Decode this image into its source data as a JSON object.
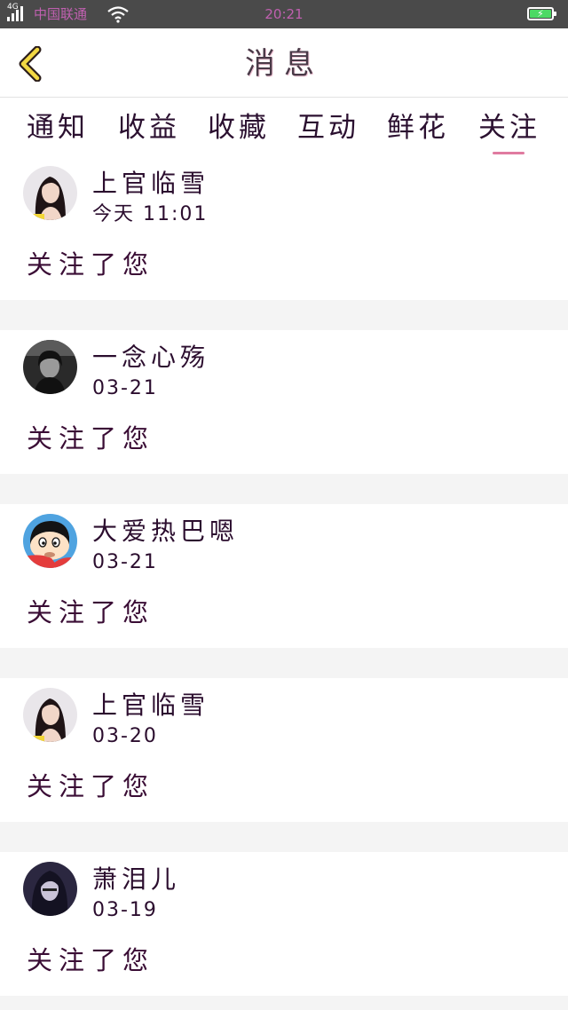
{
  "status_bar": {
    "network": "4G",
    "carrier": "中国联通",
    "time": "20:21"
  },
  "header": {
    "title": "消息"
  },
  "tabs": [
    {
      "label": "通知",
      "active": false
    },
    {
      "label": "收益",
      "active": false
    },
    {
      "label": "收藏",
      "active": false
    },
    {
      "label": "互动",
      "active": false
    },
    {
      "label": "鲜花",
      "active": false
    },
    {
      "label": "关注",
      "active": true
    }
  ],
  "colors": {
    "tab_underline": "#e07ba0",
    "text": "#2b0d2e"
  },
  "notifications": [
    {
      "name": "上官临雪",
      "time": "今天 11:01",
      "action": "关注了您",
      "avatar": "woman-long-hair-avatar"
    },
    {
      "name": "一念心殇",
      "time": "03-21",
      "action": "关注了您",
      "avatar": "dark-photo-avatar"
    },
    {
      "name": "大爱热巴嗯",
      "time": "03-21",
      "action": "关注了您",
      "avatar": "cartoon-boy-avatar"
    },
    {
      "name": "上官临雪",
      "time": "03-20",
      "action": "关注了您",
      "avatar": "woman-long-hair-avatar"
    },
    {
      "name": "萧泪儿",
      "time": "03-19",
      "action": "关注了您",
      "avatar": "night-portrait-avatar"
    }
  ]
}
